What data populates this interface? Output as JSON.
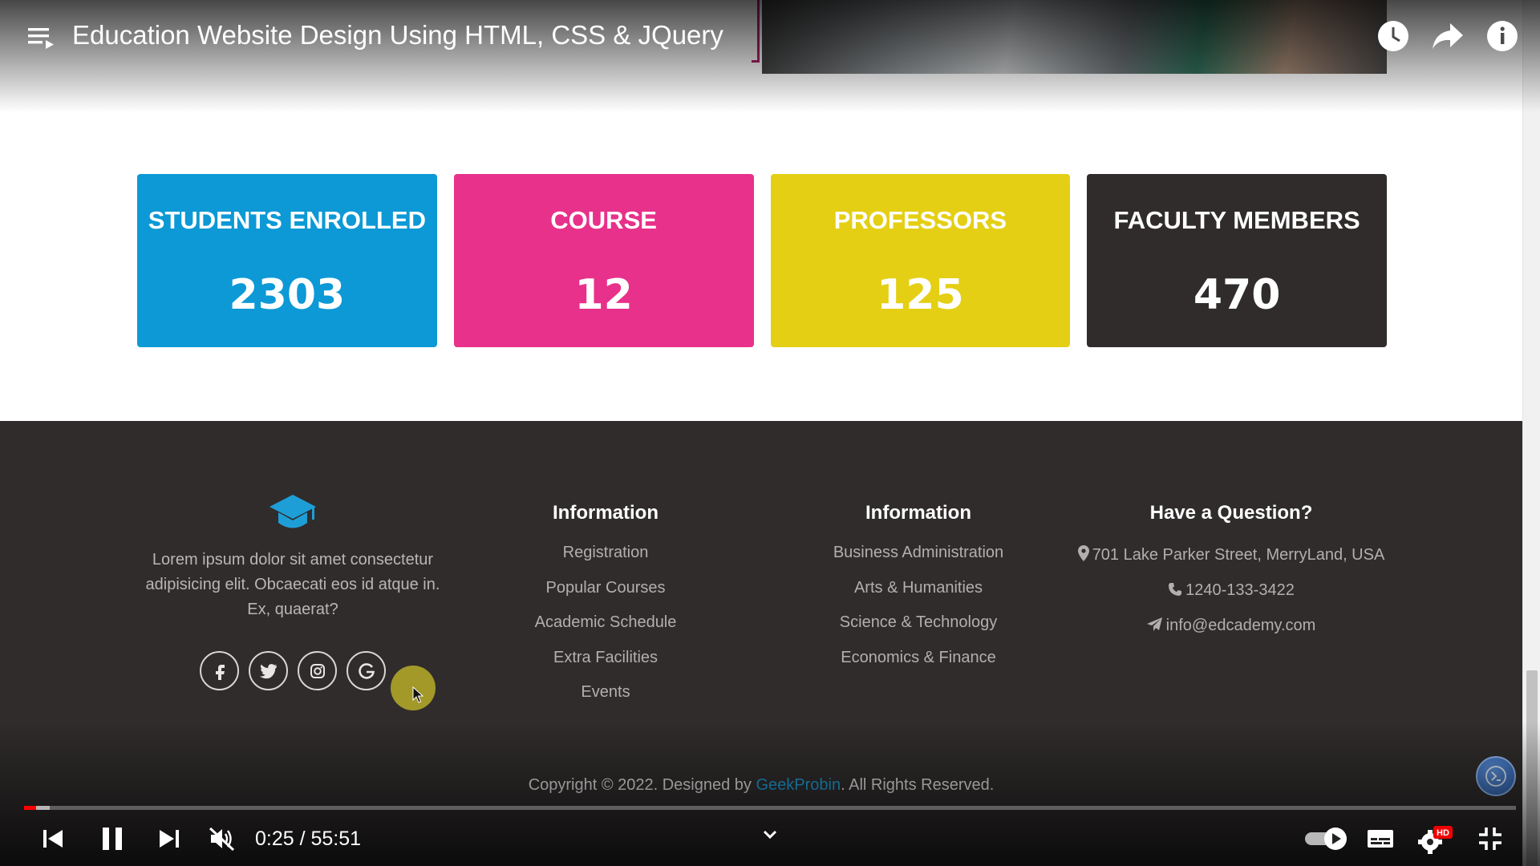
{
  "player": {
    "title": "Education Website Design Using HTML, CSS & JQuery",
    "time": "0:25 / 55:51",
    "progress_played": 0.008,
    "progress_loaded": 0.017,
    "hd_badge": "HD",
    "icons": [
      "playlist-icon",
      "watch-later-icon",
      "share-icon",
      "info-icon",
      "previous-icon",
      "pause-icon",
      "next-icon",
      "mute-icon",
      "chevron-down-icon",
      "autoplay-toggle-icon",
      "subtitles-icon",
      "settings-icon",
      "exit-fullscreen-icon"
    ]
  },
  "stats": [
    {
      "title": "STUDENTS ENROLLED",
      "value": "2303",
      "color": "#0c99d6"
    },
    {
      "title": "COURSE",
      "value": "12",
      "color": "#e7318a"
    },
    {
      "title": "PROFESSORS",
      "value": "125",
      "color": "#e4cf14"
    },
    {
      "title": "FACULTY MEMBERS",
      "value": "470",
      "color": "#302c2c"
    }
  ],
  "footer": {
    "about": {
      "logo_icon": "graduation-cap-icon",
      "logo_color": "#1e9ed7",
      "text": "Lorem ipsum dolor sit amet consectetur adipisicing elit. Obcaecati eos id atque in. Ex, quaerat?",
      "socials": [
        "facebook-icon",
        "twitter-icon",
        "instagram-icon",
        "google-icon"
      ]
    },
    "info1": {
      "heading": "Information",
      "links": [
        "Registration",
        "Popular Courses",
        "Academic Schedule",
        "Extra Facilities",
        "Events"
      ]
    },
    "info2": {
      "heading": "Information",
      "links": [
        "Business Administration",
        "Arts & Humanities",
        "Science & Technology",
        "Economics & Finance"
      ]
    },
    "question": {
      "heading": "Have a Question?",
      "address": "701 Lake Parker Street, MerryLand, USA",
      "phone": "1240-133-3422",
      "email": "info@edcademy.com"
    },
    "copyright_prefix": "Copyright © 2022. Designed by ",
    "copyright_brand": "GeekProbin",
    "copyright_suffix": ". All Rights Reserved."
  }
}
